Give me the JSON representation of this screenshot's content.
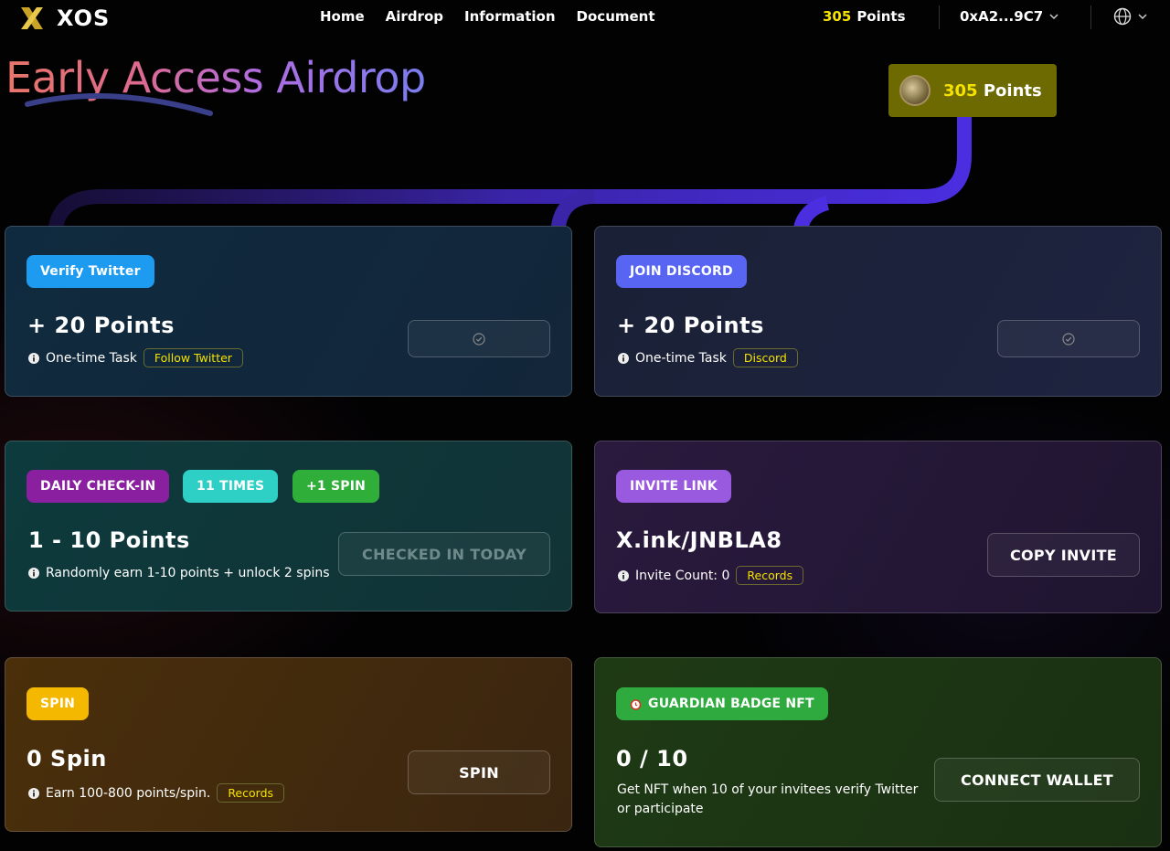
{
  "header": {
    "brand": "XOS",
    "nav": [
      "Home",
      "Airdrop",
      "Information",
      "Document"
    ],
    "points_value": "305",
    "points_label": "Points",
    "wallet": "0xA2...9C7"
  },
  "page": {
    "title": "Early Access Airdrop",
    "points_badge": {
      "value": "305",
      "label": "Points"
    }
  },
  "cards": {
    "twitter": {
      "tag": "Verify Twitter",
      "heading": "+ 20 Points",
      "note": "One-time Task",
      "link": "Follow Twitter"
    },
    "discord": {
      "tag": "JOIN DISCORD",
      "heading": "+ 20 Points",
      "note": "One-time Task",
      "link": "Discord"
    },
    "checkin": {
      "tags": [
        "DAILY CHECK-IN",
        "11 TIMES",
        "+1 SPIN"
      ],
      "heading": "1 - 10 Points",
      "note": "Randomly earn 1-10 points + unlock 2 spins",
      "button": "CHECKED IN TODAY"
    },
    "invite": {
      "tag": "INVITE LINK",
      "heading": "X.ink/JNBLA8",
      "note": "Invite Count: 0",
      "link": "Records",
      "button": "COPY INVITE"
    },
    "spin": {
      "tag": "SPIN",
      "heading": "0 Spin",
      "note": "Earn 100-800 points/spin.",
      "link": "Records",
      "button": "SPIN"
    },
    "nft": {
      "tag": "GUARDIAN BADGE NFT",
      "heading": "0 / 10",
      "note": "Get NFT when 10 of your invitees verify Twitter or participate",
      "button": "CONNECT WALLET"
    }
  },
  "colors": {
    "accent_yellow": "#f5e200",
    "twitter_tag": "#1d9bf0",
    "discord_tag": "#5865f2",
    "checkin_tag": "#8a1fa0",
    "times_tag": "#2ecfc4",
    "spin_plus_tag": "#2fae3a",
    "invite_tag": "#9a5ae0",
    "spin_tag": "#f5b800",
    "nft_tag": "#2faa3e"
  }
}
